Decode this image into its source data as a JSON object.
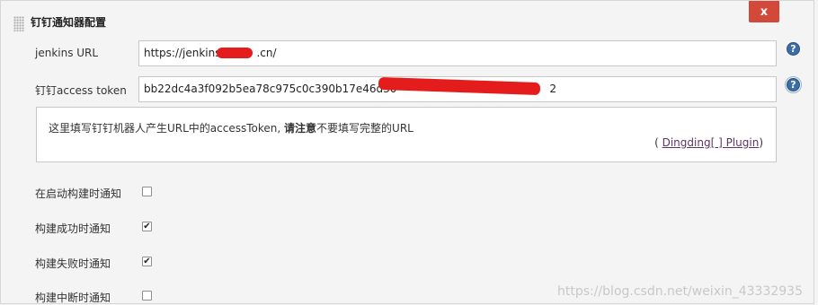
{
  "section": {
    "title": "钉钉通知器配置"
  },
  "close_button": {
    "label": "x"
  },
  "jenkins_url": {
    "label": "jenkins URL",
    "value_prefix": "https://jenkins",
    "value_suffix": ".cn/"
  },
  "access_token": {
    "label": "钉钉access token",
    "value_prefix": "bb22dc4a3f092b5ea78c975c0c390b17e46d30",
    "value_suffix": "2"
  },
  "help": {
    "text_part1": "这里填写钉钉机器人产生URL中的accessToken, ",
    "text_bold": "请注意",
    "text_part2": "不要填写完整的URL",
    "plugin_open": "(",
    "plugin_link": "Dingding[ ] Plugin",
    "plugin_close": ")"
  },
  "help_icon": {
    "glyph": "?"
  },
  "options": [
    {
      "label": "在启动构建时通知",
      "checked": false
    },
    {
      "label": "构建成功时通知",
      "checked": true
    },
    {
      "label": "构建失败时通知",
      "checked": true
    },
    {
      "label": "构建中断时通知",
      "checked": false
    }
  ],
  "checkmark": "✔",
  "watermark": "https://blog.csdn.net/weixin_43332935",
  "colors": {
    "close_bg": "#d24939",
    "redaction": "#e41c1c",
    "link": "#5c3566",
    "help_icon": "#3a6ea8"
  }
}
